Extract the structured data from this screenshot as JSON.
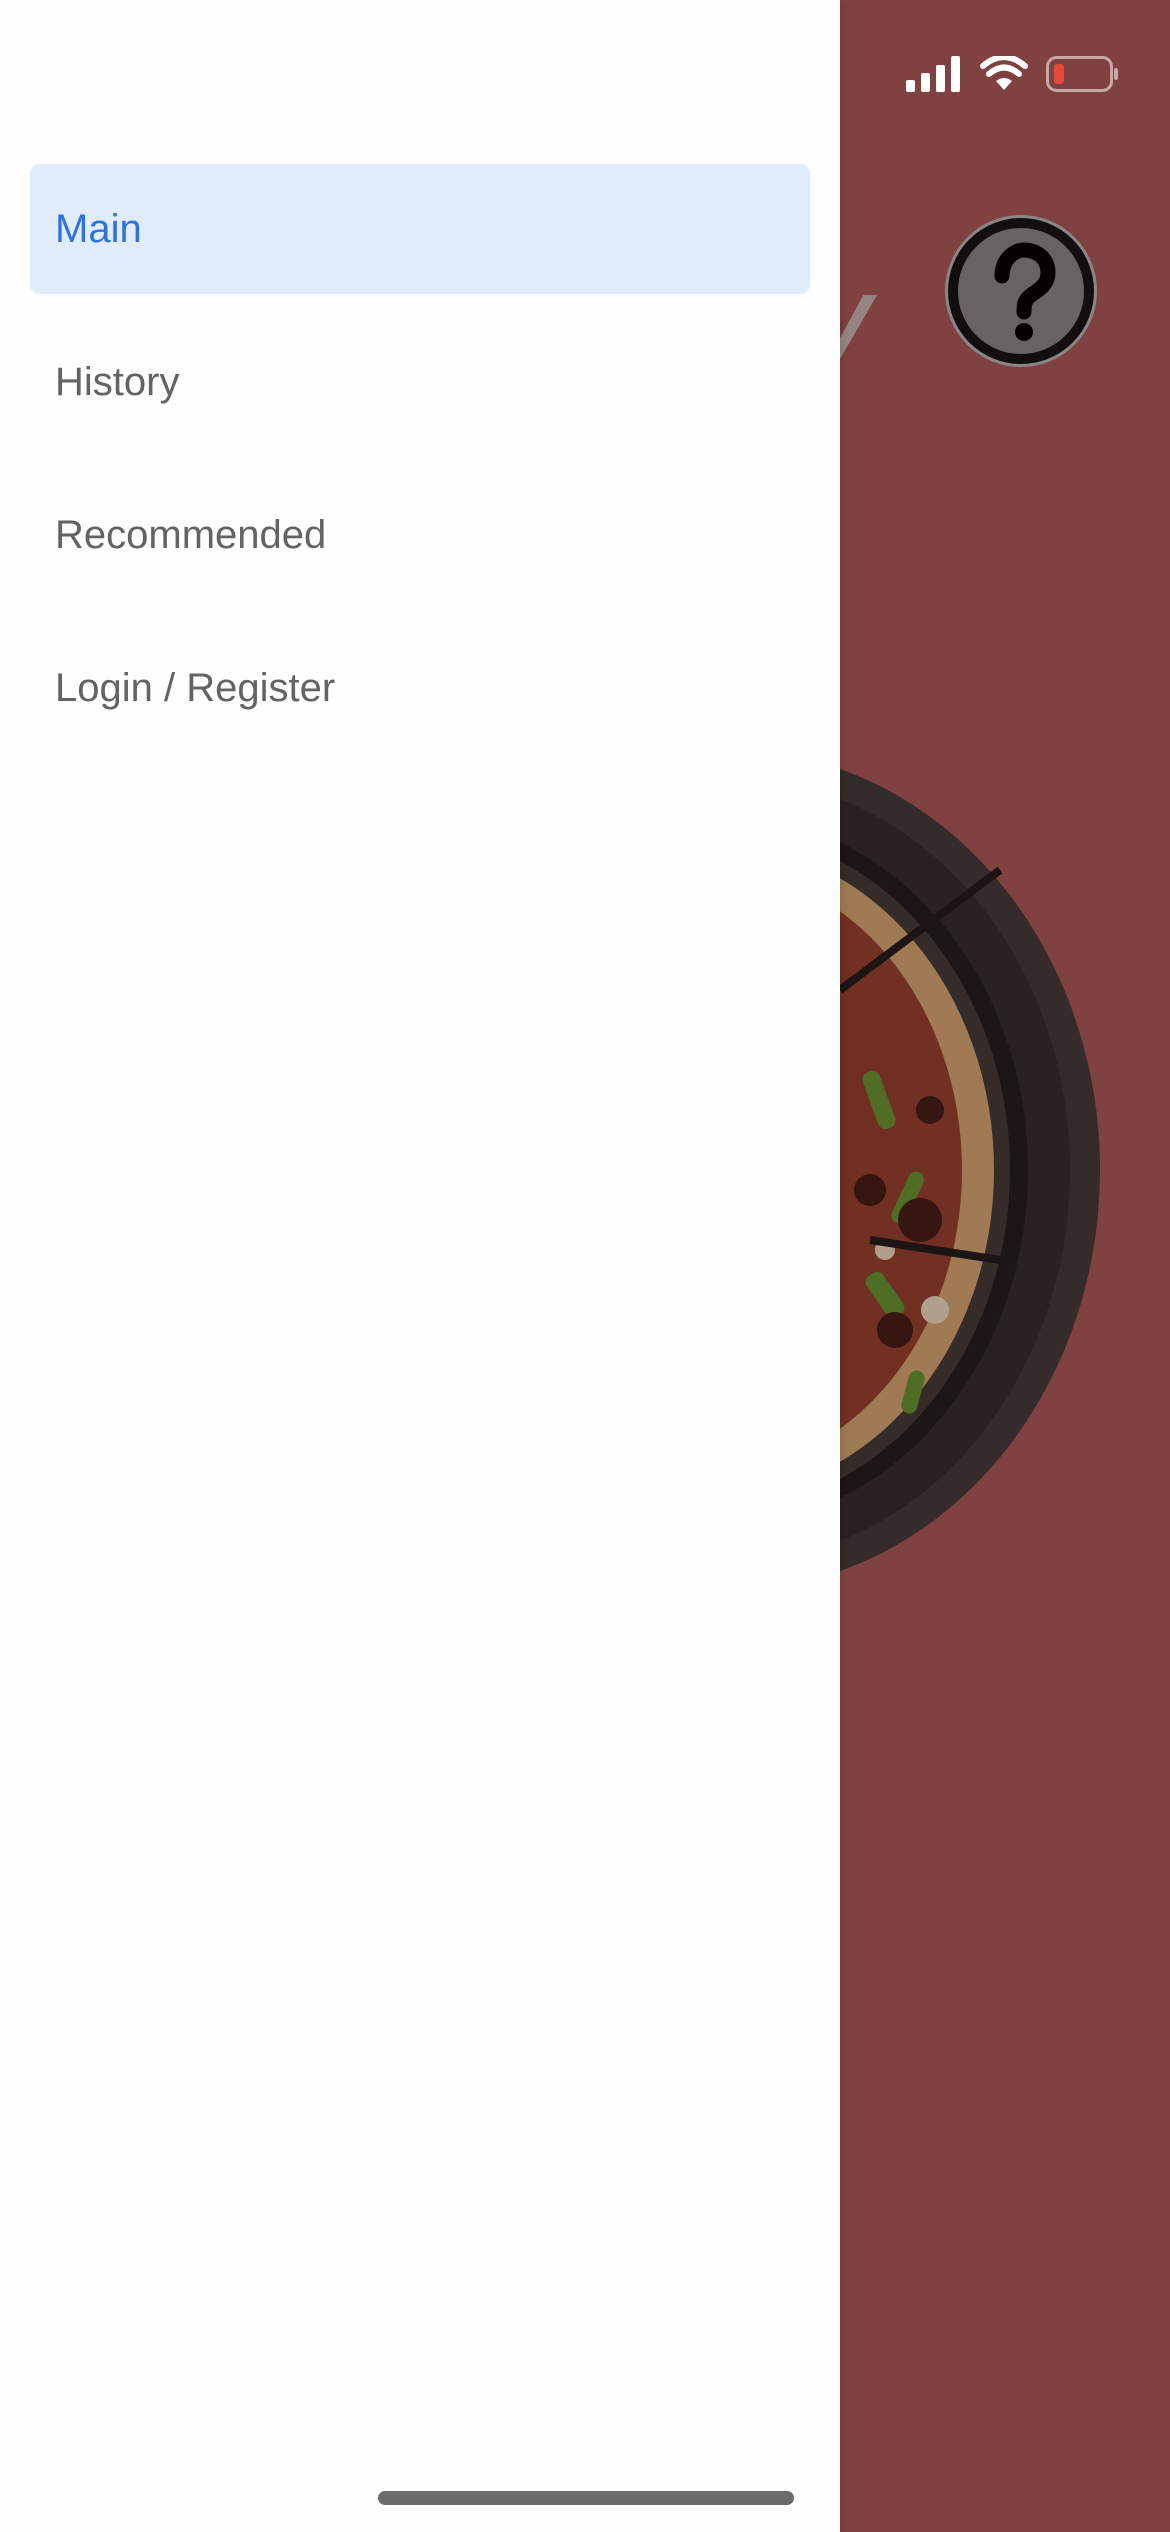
{
  "drawer": {
    "items": [
      {
        "label": "Main",
        "active": true
      },
      {
        "label": "History",
        "active": false
      },
      {
        "label": "Recommended",
        "active": false
      },
      {
        "label": "Login / Register",
        "active": false
      }
    ]
  },
  "background": {
    "title_fragment": "y",
    "help_icon": "question-mark-icon",
    "image": "pizza"
  },
  "status_bar": {
    "signal_icon": "cellular-signal-icon",
    "wifi_icon": "wifi-icon",
    "battery_icon": "battery-low-icon"
  },
  "colors": {
    "background_app": "#7a4240",
    "drawer_bg": "#fdfdfd",
    "active_item_bg": "#e1ecfa",
    "active_item_text": "#2f72dd",
    "item_text": "#636363",
    "battery_low": "#e5483e"
  }
}
